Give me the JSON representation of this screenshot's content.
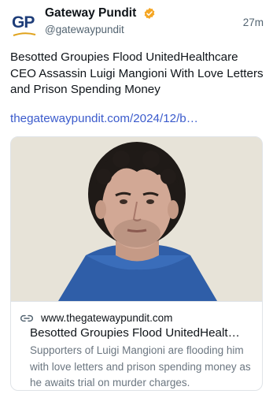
{
  "author": {
    "display_name": "Gateway Pundit",
    "handle": "@gatewaypundit",
    "logo_text": "GP",
    "verified_icon": "verified-badge-icon"
  },
  "post": {
    "timestamp": "27m",
    "text": "Besotted Groupies Flood UnitedHealthcare CEO Assassin Luigi Mangioni With Love Letters and Prison Spending Money",
    "link_text": "thegatewaypundit.com/2024/12/b…"
  },
  "card": {
    "domain": "www.thegatewaypundit.com",
    "domain_icon": "link-icon",
    "title": "Besotted Groupies Flood UnitedHealt…",
    "description": "Supporters of Luigi Mangioni are flooding him with love letters and prison spending money as he awaits trial on murder charges."
  },
  "colors": {
    "link": "#3b5bcc",
    "verified": "#f5a623",
    "secondary_text": "#536471",
    "logo_navy": "#1d3c78",
    "logo_accent": "#e0a21b"
  }
}
